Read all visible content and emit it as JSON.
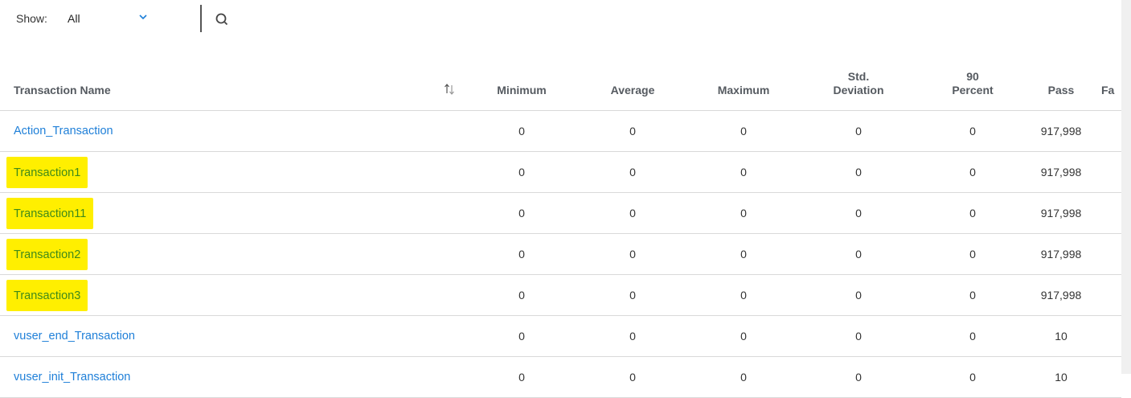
{
  "toolbar": {
    "show_label": "Show:",
    "show_value": "All",
    "chevron_icon": "chevron-down-icon",
    "search_icon": "search-icon",
    "accent_color": "#1e7fd8"
  },
  "table": {
    "headers": {
      "name": "Transaction Name",
      "minimum": "Minimum",
      "average": "Average",
      "maximum": "Maximum",
      "std_line1": "Std.",
      "std_line2": "Deviation",
      "p90_line1": "90",
      "p90_line2": "Percent",
      "pass": "Pass",
      "fail_cut": "Fa"
    },
    "sort_icon": "sort-arrows-icon",
    "highlight_color": "#ffef00",
    "rows": [
      {
        "name": "Action_Transaction",
        "minimum": "0",
        "average": "0",
        "maximum": "0",
        "std": "0",
        "p90": "0",
        "pass": "917,998",
        "highlighted": false
      },
      {
        "name": "Transaction1",
        "minimum": "0",
        "average": "0",
        "maximum": "0",
        "std": "0",
        "p90": "0",
        "pass": "917,998",
        "highlighted": true
      },
      {
        "name": "Transaction11",
        "minimum": "0",
        "average": "0",
        "maximum": "0",
        "std": "0",
        "p90": "0",
        "pass": "917,998",
        "highlighted": true
      },
      {
        "name": "Transaction2",
        "minimum": "0",
        "average": "0",
        "maximum": "0",
        "std": "0",
        "p90": "0",
        "pass": "917,998",
        "highlighted": true
      },
      {
        "name": "Transaction3",
        "minimum": "0",
        "average": "0",
        "maximum": "0",
        "std": "0",
        "p90": "0",
        "pass": "917,998",
        "highlighted": true
      },
      {
        "name": "vuser_end_Transaction",
        "minimum": "0",
        "average": "0",
        "maximum": "0",
        "std": "0",
        "p90": "0",
        "pass": "10",
        "highlighted": false
      },
      {
        "name": "vuser_init_Transaction",
        "minimum": "0",
        "average": "0",
        "maximum": "0",
        "std": "0",
        "p90": "0",
        "pass": "10",
        "highlighted": false
      }
    ]
  }
}
